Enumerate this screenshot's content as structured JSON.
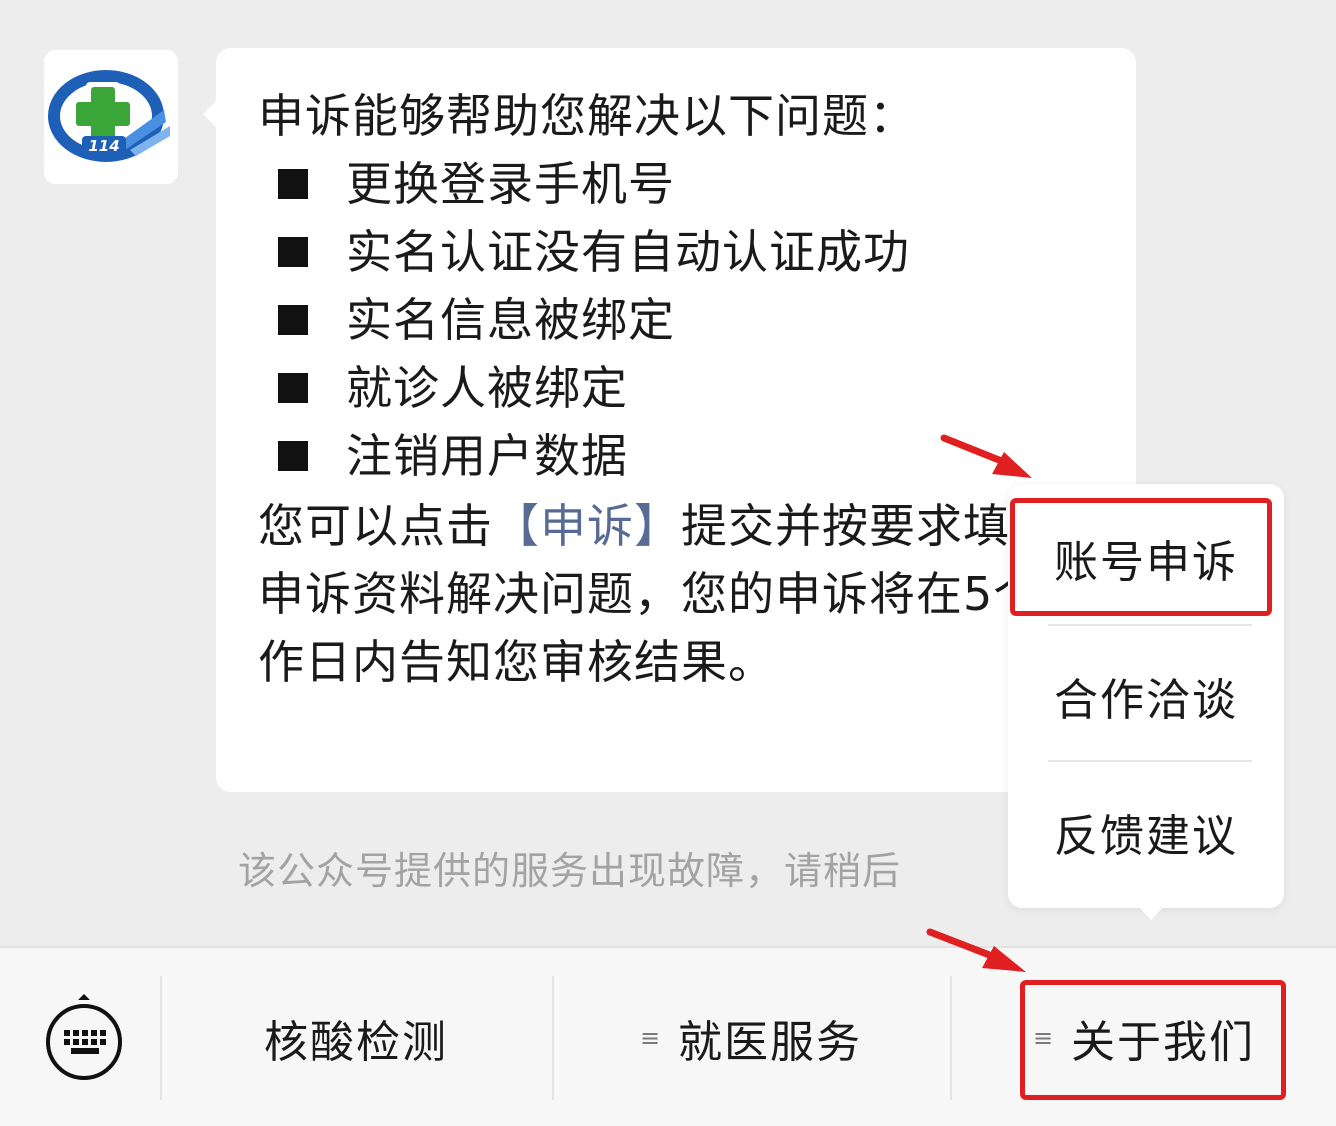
{
  "chat": {
    "account_avatar": "114-cross-logo",
    "avatar_text": "114",
    "heading": "申诉能够帮助您解决以下问题：",
    "problems": [
      "更换登录手机号",
      "实名认证没有自动认证成功",
      "实名信息被绑定",
      "就诊人被绑定",
      "注销用户数据"
    ],
    "closing_before": "您可以点击",
    "closing_link": "【申诉】",
    "closing_after": "提交并按要求填写申诉资料解决问题，您的申诉将在5个工作日内告知您审核结果。",
    "system_notice": "该公众号提供的服务出现故障，请稍后"
  },
  "popup_menu": {
    "items": [
      "账号申诉",
      "合作洽谈",
      "反馈建议"
    ]
  },
  "menu_bar": {
    "keyboard_icon": "keyboard-icon",
    "submenu_icon": "list-icon",
    "submenu_glyph": "≡",
    "items": [
      "核酸检测",
      "就医服务",
      "关于我们"
    ]
  },
  "colors": {
    "background": "#ededed",
    "bubble": "#ffffff",
    "link": "#576b95",
    "notice": "#a3a3a3",
    "highlight": "#e02020",
    "logo_blue": "#1e5fb8",
    "logo_green": "#3aa63a"
  }
}
